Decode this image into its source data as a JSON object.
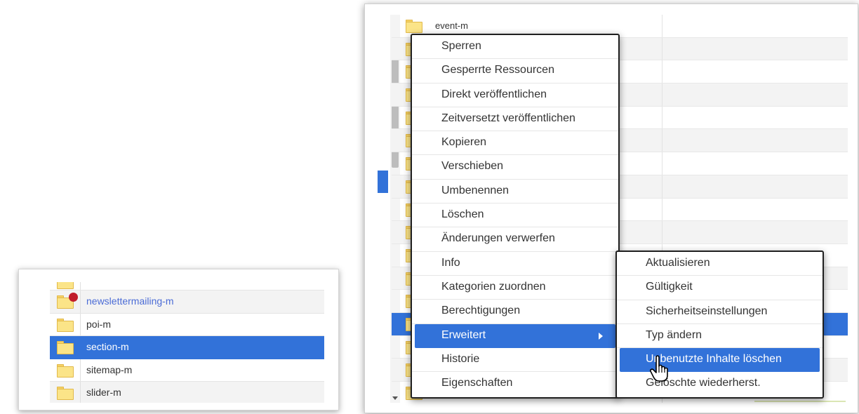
{
  "small_tree": {
    "rows": [
      {
        "label": "",
        "partial": true,
        "alt": false,
        "selected": false,
        "locked": false,
        "link": false
      },
      {
        "label": "newslettermailing-m",
        "alt": true,
        "selected": false,
        "locked": true,
        "link": true
      },
      {
        "label": "poi-m",
        "alt": false,
        "selected": false,
        "locked": false,
        "link": false
      },
      {
        "label": "section-m",
        "alt": false,
        "selected": true,
        "locked": false,
        "link": false
      },
      {
        "label": "sitemap-m",
        "alt": false,
        "selected": false,
        "locked": false,
        "link": false
      },
      {
        "label": "slider-m",
        "alt": true,
        "selected": false,
        "locked": false,
        "link": false
      }
    ]
  },
  "big_tree": {
    "rows": [
      {
        "label": "event-m",
        "alt": false,
        "selected": false
      },
      {
        "label": "",
        "alt": true,
        "selected": false
      },
      {
        "label": "",
        "alt": false,
        "selected": false
      },
      {
        "label": "",
        "alt": true,
        "selected": false
      },
      {
        "label": "",
        "alt": false,
        "selected": false
      },
      {
        "label": "",
        "alt": true,
        "selected": false
      },
      {
        "label": "",
        "alt": false,
        "selected": false
      },
      {
        "label": "",
        "alt": true,
        "selected": false
      },
      {
        "label": "",
        "alt": false,
        "selected": false
      },
      {
        "label": "",
        "alt": true,
        "selected": false
      },
      {
        "label": "",
        "alt": false,
        "selected": false
      },
      {
        "label": "",
        "alt": true,
        "selected": false
      },
      {
        "label": "",
        "alt": false,
        "selected": false
      },
      {
        "label": "",
        "alt": false,
        "selected": true
      },
      {
        "label": "",
        "alt": false,
        "selected": false
      },
      {
        "label": "",
        "alt": true,
        "selected": false
      },
      {
        "label": "",
        "alt": false,
        "selected": false
      }
    ]
  },
  "context_menu": {
    "items": [
      {
        "label": "Sperren",
        "active": false,
        "submenu": false
      },
      {
        "label": "Gesperrte Ressourcen",
        "active": false,
        "submenu": false
      },
      {
        "label": "Direkt veröffentlichen",
        "active": false,
        "submenu": false
      },
      {
        "label": "Zeitversetzt veröffentlichen",
        "active": false,
        "submenu": false
      },
      {
        "label": "Kopieren",
        "active": false,
        "submenu": false
      },
      {
        "label": "Verschieben",
        "active": false,
        "submenu": false
      },
      {
        "label": "Umbenennen",
        "active": false,
        "submenu": false
      },
      {
        "label": "Löschen",
        "active": false,
        "submenu": false
      },
      {
        "label": "Änderungen verwerfen",
        "active": false,
        "submenu": false
      },
      {
        "label": "Info",
        "active": false,
        "submenu": false
      },
      {
        "label": "Kategorien zuordnen",
        "active": false,
        "submenu": false
      },
      {
        "label": "Berechtigungen",
        "active": false,
        "submenu": false
      },
      {
        "label": "Erweitert",
        "active": true,
        "submenu": true
      },
      {
        "label": "Historie",
        "active": false,
        "submenu": false
      },
      {
        "label": "Eigenschaften",
        "active": false,
        "submenu": false
      }
    ]
  },
  "submenu": {
    "items": [
      {
        "label": "Aktualisieren",
        "active": false
      },
      {
        "label": "Gültigkeit",
        "active": false
      },
      {
        "label": "Sicherheitseinstellungen",
        "active": false
      },
      {
        "label": "Typ ändern",
        "active": false
      },
      {
        "label": "Unbenutzte Inhalte löschen",
        "active": true
      },
      {
        "label": "Gelöschte wiederherst.",
        "active": false
      }
    ]
  },
  "colors": {
    "selection": "#3272d9",
    "folder": "#fbe488",
    "lock_badge": "#c11d2c",
    "link": "#4b6cd6"
  },
  "icons": {
    "folder": "folder-icon",
    "lock_badge": "lock-badge-icon",
    "submenu_arrow": "chevron-right-icon",
    "cursor": "hand-pointer-icon"
  }
}
